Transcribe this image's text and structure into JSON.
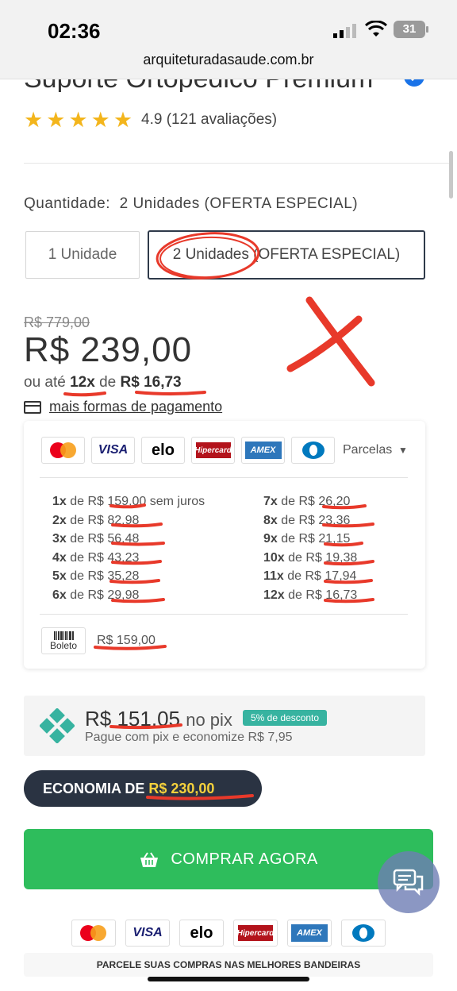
{
  "status": {
    "time": "02:36",
    "battery": "31"
  },
  "browser": {
    "url": "arquiteturadasaude.com.br"
  },
  "product": {
    "title": "Suporte Ortopédico Premium",
    "rating_text": "4.9 (121 avaliações)",
    "stars": 5
  },
  "quantity": {
    "label": "Quantidade:",
    "selected": "2 Unidades (OFERTA ESPECIAL)",
    "options": [
      "1 Unidade",
      "2 Unidades (OFERTA ESPECIAL)"
    ]
  },
  "pricing": {
    "old_price": "R$ 779,00",
    "price": "R$ 239,00",
    "installment_prefix": "ou até",
    "installment_count": "12x",
    "installment_mid": "de",
    "installment_value": "R$ 16,73",
    "more_payments": "mais formas de pagamento"
  },
  "payment_card": {
    "brands": [
      "VISA",
      "elo",
      "Hipercard",
      "AMEX"
    ],
    "parcelas_label": "Parcelas",
    "installments_left": [
      {
        "n": "1x",
        "text": " de R$ 159,00 sem juros"
      },
      {
        "n": "2x",
        "text": " de R$ 82,98"
      },
      {
        "n": "3x",
        "text": " de R$ 56,48"
      },
      {
        "n": "4x",
        "text": " de R$ 43,23"
      },
      {
        "n": "5x",
        "text": " de R$ 35,28"
      },
      {
        "n": "6x",
        "text": " de R$ 29,98"
      }
    ],
    "installments_right": [
      {
        "n": "7x",
        "text": " de R$ 26,20"
      },
      {
        "n": "8x",
        "text": " de R$ 23,36"
      },
      {
        "n": "9x",
        "text": " de R$ 21,15"
      },
      {
        "n": "10x",
        "text": " de R$ 19,38"
      },
      {
        "n": "11x",
        "text": " de R$ 17,94"
      },
      {
        "n": "12x",
        "text": " de R$ 16,73"
      }
    ],
    "boleto_label": "Boleto",
    "boleto_price": "R$ 159,00"
  },
  "pix": {
    "price": "R$ 151,05",
    "suffix": "no pix",
    "badge": "5% de desconto",
    "subtitle": "Pague com pix e economize R$ 7,95"
  },
  "economia": {
    "label": "ECONOMIA DE",
    "value": "R$ 230,00"
  },
  "buy_button": {
    "label": "COMPRAR AGORA"
  },
  "footer": {
    "text": "PARCELE SUAS COMPRAS NAS MELHORES BANDEIRAS"
  },
  "colors": {
    "buy": "#2ebd5c",
    "economia_bg": "#2a3342",
    "pix_badge": "#37b3a0",
    "annotation": "#e8392a",
    "stars": "#f3b51c"
  }
}
